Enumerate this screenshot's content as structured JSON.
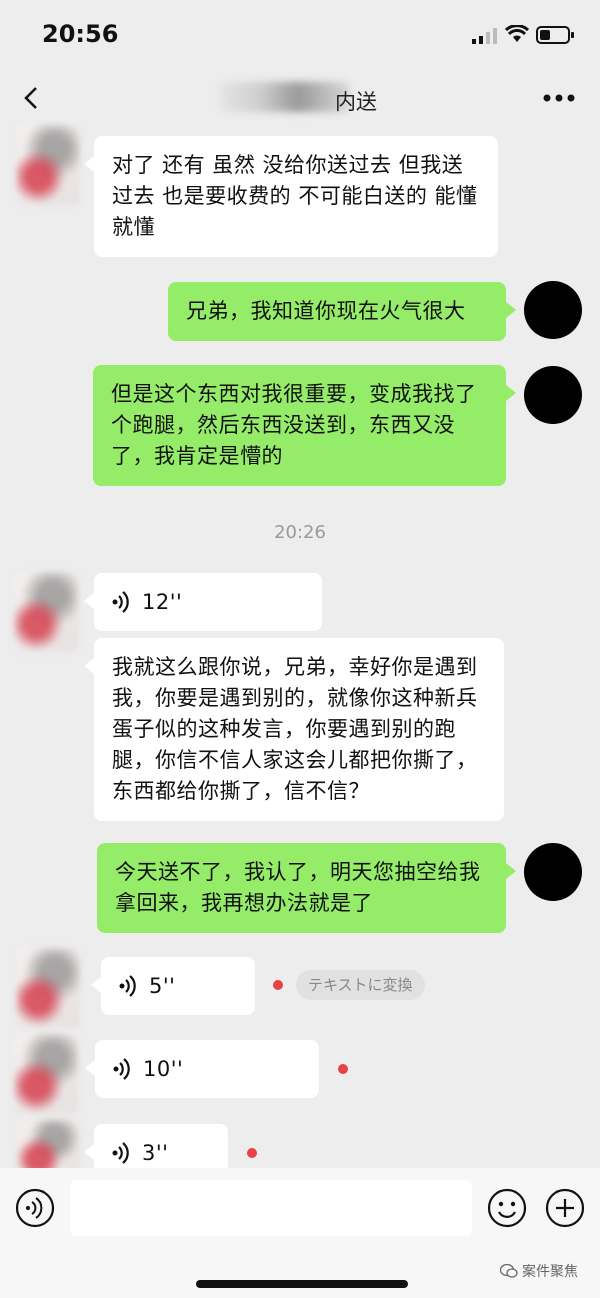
{
  "status_bar": {
    "time": "20:56"
  },
  "nav": {
    "title_visible": "内送"
  },
  "messages": [
    {
      "side": "in",
      "text": "对了 还有 虽然 没给你送过去 但我送过去 也是要收费的 不可能白送的 能懂就懂"
    },
    {
      "side": "out",
      "text": "兄弟，我知道你现在火气很大"
    },
    {
      "side": "out",
      "text": "但是这个东西对我很重要，变成我找了个跑腿，然后东西没送到，东西又没了，我肯定是懵的"
    },
    {
      "side": "in",
      "type": "voice",
      "duration": "12''"
    },
    {
      "side": "in",
      "text": "我就这么跟你说，兄弟，幸好你是遇到我，你要是遇到别的，就像你这种新兵蛋子似的这种发言，你要遇到别的跑腿，你信不信人家这会儿都把你撕了，东西都给你撕了，信不信？"
    },
    {
      "side": "out",
      "text": "今天送不了，我认了，明天您抽空给我拿回来，我再想办法就是了"
    },
    {
      "side": "in",
      "type": "voice",
      "duration": "5''"
    },
    {
      "side": "in",
      "type": "voice",
      "duration": "10''"
    },
    {
      "side": "in",
      "type": "voice",
      "duration": "3''"
    }
  ],
  "timestamp": "20:26",
  "transcribe_label": "テキストに変換",
  "watermark": "案件聚焦",
  "colors": {
    "outgoing_bubble": "#95ec69",
    "incoming_bubble": "#ffffff",
    "background": "#ededed",
    "unread_dot": "#e64343"
  }
}
